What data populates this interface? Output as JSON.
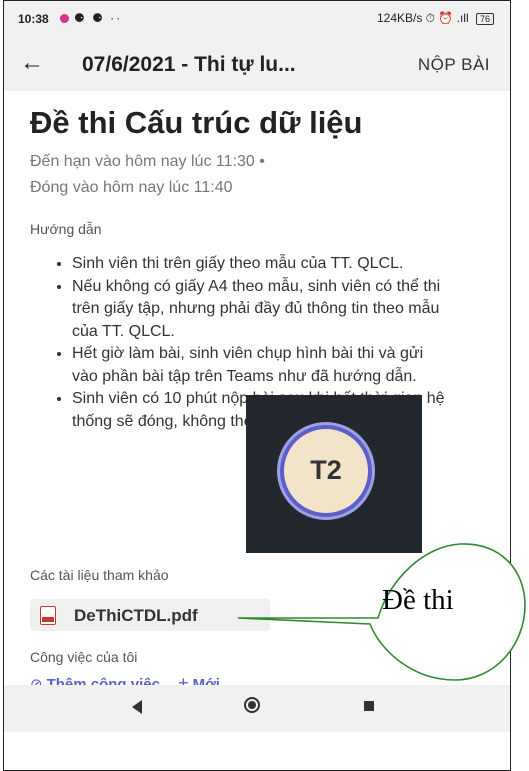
{
  "status_bar": {
    "time": "10:38",
    "icons": "⚈ ⚈ ··",
    "right": "124KB/s ⏱ ⏰ .ıll",
    "battery": "76"
  },
  "app_bar": {
    "title": "07/6/2021 - Thi tự lu...",
    "submit_label": "NỘP BÀI"
  },
  "assignment": {
    "title": "Đề thi Cấu trúc dữ liệu",
    "due_text": "Đến hạn vào hôm nay lúc 11:30  •",
    "close_text": "Đóng vào hôm nay lúc 11:40"
  },
  "instructions": {
    "heading": "Hướng dẫn",
    "items": [
      "Sinh viên thi trên giấy theo mẫu của TT. QLCL.",
      "Nếu không có giấy A4 theo mẫu, sinh viên có thể thi trên giấy tập, nhưng phải đầy đủ thông tin theo mẫu của TT. QLCL.",
      "Hết giờ làm bài, sinh viên chụp hình bài thi và gửi vào phần bài tập trên Teams như đã hướng dẫn.",
      "Sinh viên có 10 phút nộp bài sau khi hết thời gian hệ thống sẽ đóng, không thể gửi bài."
    ]
  },
  "references": {
    "heading": "Các tài liệu tham khảo",
    "file_name": "DeThiCTDL.pdf"
  },
  "my_work": {
    "heading": "Công việc của tôi",
    "add_work": "Thêm công việc",
    "new": "Mới"
  },
  "overlay": {
    "avatar_initials": "T2",
    "callout_text": "Đề thi"
  },
  "colors": {
    "accent": "#5b5fc7",
    "callout_border": "#2e8b2e"
  }
}
